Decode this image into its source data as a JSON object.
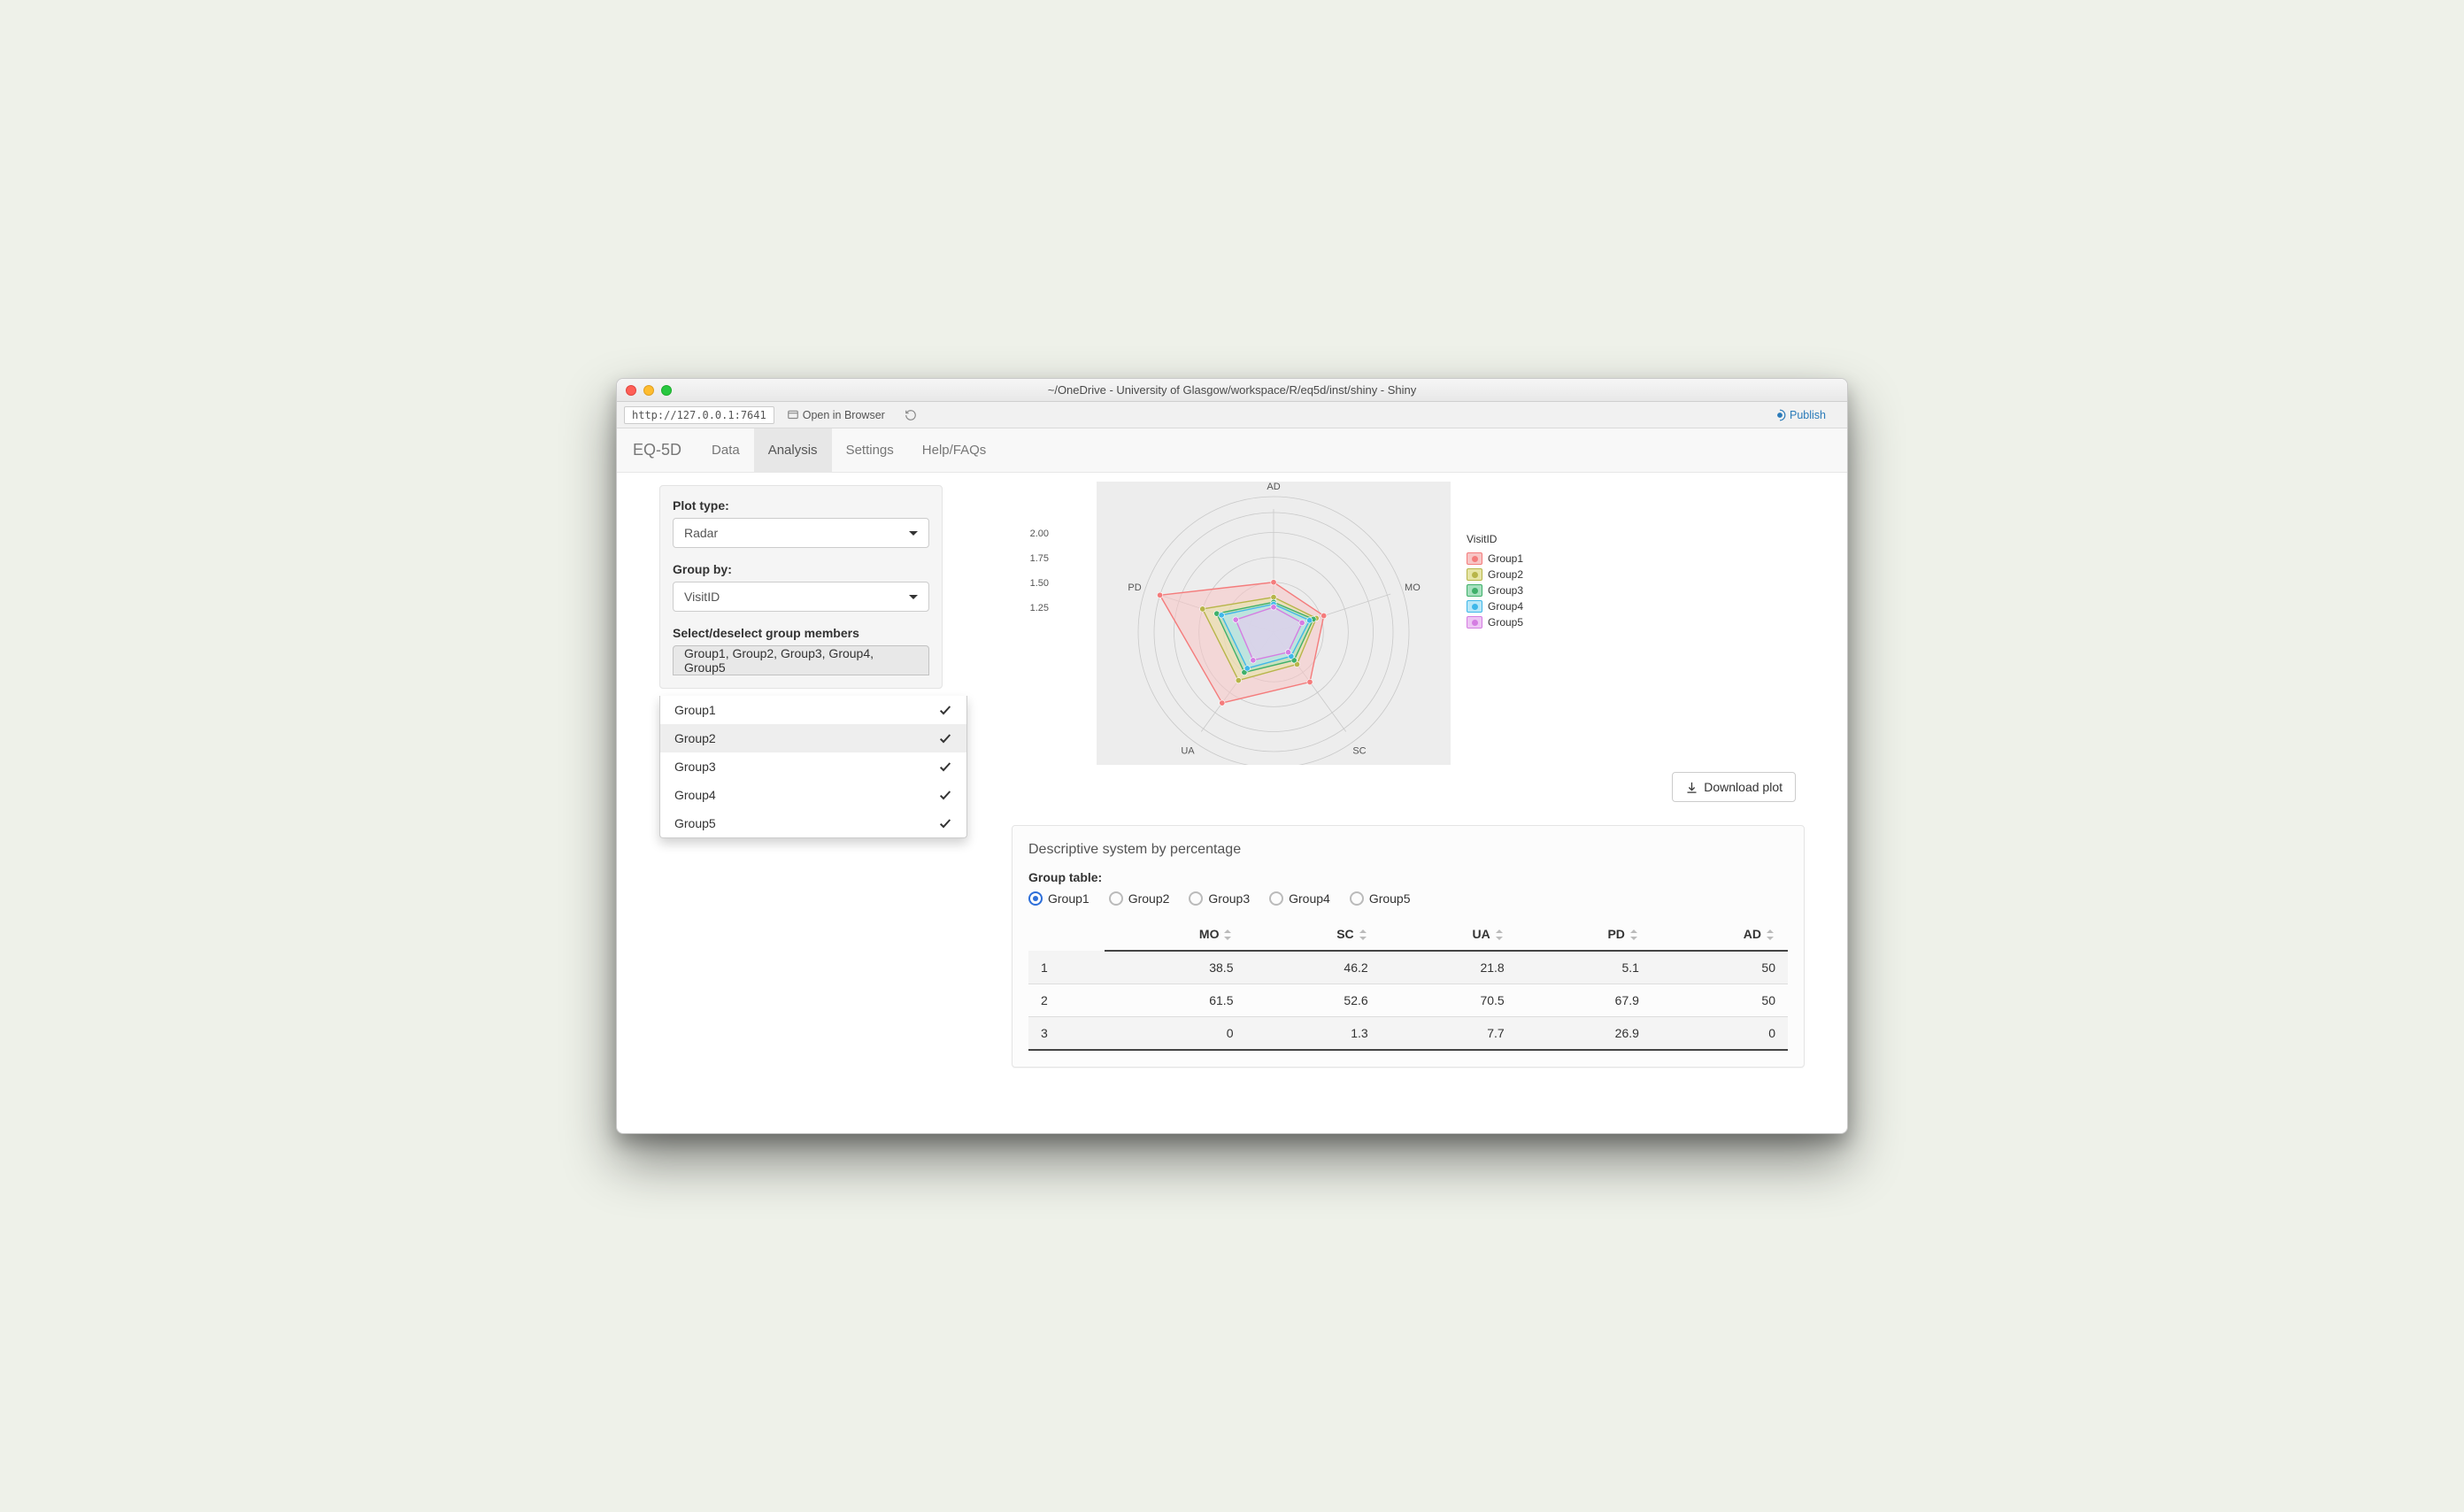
{
  "window": {
    "title": "~/OneDrive - University of Glasgow/workspace/R/eq5d/inst/shiny - Shiny"
  },
  "urlbar": {
    "address": "http://127.0.0.1:7641",
    "open_in_browser": "Open in Browser",
    "publish": "Publish"
  },
  "navbar": {
    "brand": "EQ-5D",
    "items": [
      "Data",
      "Analysis",
      "Settings",
      "Help/FAQs"
    ],
    "active_index": 1
  },
  "sidebar": {
    "plot_type": {
      "label": "Plot type:",
      "value": "Radar"
    },
    "group_by": {
      "label": "Group by:",
      "value": "VisitID"
    },
    "members": {
      "label": "Select/deselect group members",
      "summary": "Group1, Group2, Group3, Group4, Group5",
      "options": [
        "Group1",
        "Group2",
        "Group3",
        "Group4",
        "Group5"
      ],
      "highlight_index": 1
    }
  },
  "chart_data": {
    "type": "radar",
    "axes": [
      "AD",
      "MO",
      "SC",
      "UA",
      "PD"
    ],
    "ticks": [
      1.25,
      1.5,
      1.75,
      2.0
    ],
    "range": [
      1.0,
      2.2
    ],
    "legend_title": "VisitID",
    "series": [
      {
        "name": "Group1",
        "color": "#f47c7c",
        "fill": "#f7c5c5",
        "values": {
          "AD": 1.5,
          "MO": 1.53,
          "SC": 1.62,
          "UA": 1.88,
          "PD": 2.2
        }
      },
      {
        "name": "Group2",
        "color": "#b7b549",
        "fill": "#e6e5a6",
        "values": {
          "AD": 1.35,
          "MO": 1.45,
          "SC": 1.4,
          "UA": 1.6,
          "PD": 1.75
        }
      },
      {
        "name": "Group3",
        "color": "#3fb06a",
        "fill": "#a7e0bf",
        "values": {
          "AD": 1.3,
          "MO": 1.42,
          "SC": 1.35,
          "UA": 1.5,
          "PD": 1.6
        }
      },
      {
        "name": "Group4",
        "color": "#3fb7e9",
        "fill": "#b8e7f8",
        "values": {
          "AD": 1.28,
          "MO": 1.38,
          "SC": 1.3,
          "UA": 1.45,
          "PD": 1.55
        }
      },
      {
        "name": "Group5",
        "color": "#d57de2",
        "fill": "#edc6f3",
        "values": {
          "AD": 1.25,
          "MO": 1.3,
          "SC": 1.25,
          "UA": 1.35,
          "PD": 1.4
        }
      }
    ]
  },
  "download_plot": "Download plot",
  "panel": {
    "title": "Descriptive system by percentage",
    "group_table_label": "Group table:",
    "radios": [
      "Group1",
      "Group2",
      "Group3",
      "Group4",
      "Group5"
    ],
    "radio_checked": 0,
    "columns": [
      "MO",
      "SC",
      "UA",
      "PD",
      "AD"
    ],
    "rows": [
      {
        "label": "1",
        "cells": [
          38.5,
          46.2,
          21.8,
          5.1,
          50
        ]
      },
      {
        "label": "2",
        "cells": [
          61.5,
          52.6,
          70.5,
          67.9,
          50
        ]
      },
      {
        "label": "3",
        "cells": [
          0,
          1.3,
          7.7,
          26.9,
          0
        ]
      }
    ]
  }
}
